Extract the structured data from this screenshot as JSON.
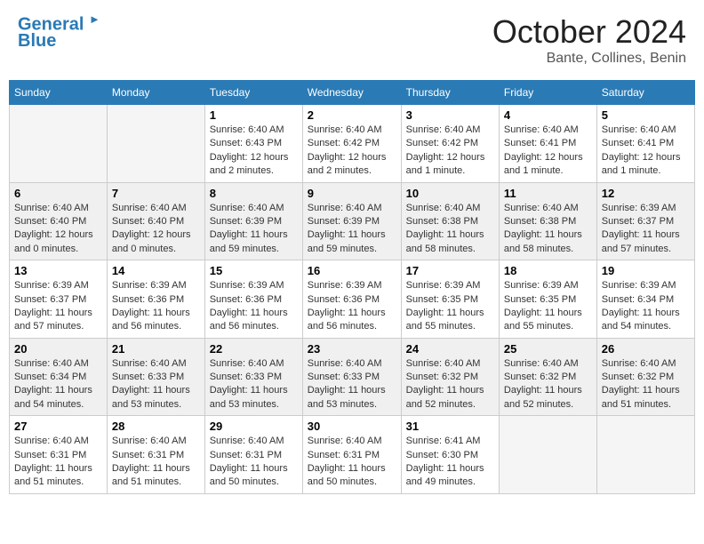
{
  "header": {
    "logo_line1": "General",
    "logo_line2": "Blue",
    "title": "October 2024",
    "subtitle": "Bante, Collines, Benin"
  },
  "days_of_week": [
    "Sunday",
    "Monday",
    "Tuesday",
    "Wednesday",
    "Thursday",
    "Friday",
    "Saturday"
  ],
  "weeks": [
    [
      {
        "day": "",
        "info": ""
      },
      {
        "day": "",
        "info": ""
      },
      {
        "day": "1",
        "info": "Sunrise: 6:40 AM\nSunset: 6:43 PM\nDaylight: 12 hours and 2 minutes."
      },
      {
        "day": "2",
        "info": "Sunrise: 6:40 AM\nSunset: 6:42 PM\nDaylight: 12 hours and 2 minutes."
      },
      {
        "day": "3",
        "info": "Sunrise: 6:40 AM\nSunset: 6:42 PM\nDaylight: 12 hours and 1 minute."
      },
      {
        "day": "4",
        "info": "Sunrise: 6:40 AM\nSunset: 6:41 PM\nDaylight: 12 hours and 1 minute."
      },
      {
        "day": "5",
        "info": "Sunrise: 6:40 AM\nSunset: 6:41 PM\nDaylight: 12 hours and 1 minute."
      }
    ],
    [
      {
        "day": "6",
        "info": "Sunrise: 6:40 AM\nSunset: 6:40 PM\nDaylight: 12 hours and 0 minutes."
      },
      {
        "day": "7",
        "info": "Sunrise: 6:40 AM\nSunset: 6:40 PM\nDaylight: 12 hours and 0 minutes."
      },
      {
        "day": "8",
        "info": "Sunrise: 6:40 AM\nSunset: 6:39 PM\nDaylight: 11 hours and 59 minutes."
      },
      {
        "day": "9",
        "info": "Sunrise: 6:40 AM\nSunset: 6:39 PM\nDaylight: 11 hours and 59 minutes."
      },
      {
        "day": "10",
        "info": "Sunrise: 6:40 AM\nSunset: 6:38 PM\nDaylight: 11 hours and 58 minutes."
      },
      {
        "day": "11",
        "info": "Sunrise: 6:40 AM\nSunset: 6:38 PM\nDaylight: 11 hours and 58 minutes."
      },
      {
        "day": "12",
        "info": "Sunrise: 6:39 AM\nSunset: 6:37 PM\nDaylight: 11 hours and 57 minutes."
      }
    ],
    [
      {
        "day": "13",
        "info": "Sunrise: 6:39 AM\nSunset: 6:37 PM\nDaylight: 11 hours and 57 minutes."
      },
      {
        "day": "14",
        "info": "Sunrise: 6:39 AM\nSunset: 6:36 PM\nDaylight: 11 hours and 56 minutes."
      },
      {
        "day": "15",
        "info": "Sunrise: 6:39 AM\nSunset: 6:36 PM\nDaylight: 11 hours and 56 minutes."
      },
      {
        "day": "16",
        "info": "Sunrise: 6:39 AM\nSunset: 6:36 PM\nDaylight: 11 hours and 56 minutes."
      },
      {
        "day": "17",
        "info": "Sunrise: 6:39 AM\nSunset: 6:35 PM\nDaylight: 11 hours and 55 minutes."
      },
      {
        "day": "18",
        "info": "Sunrise: 6:39 AM\nSunset: 6:35 PM\nDaylight: 11 hours and 55 minutes."
      },
      {
        "day": "19",
        "info": "Sunrise: 6:39 AM\nSunset: 6:34 PM\nDaylight: 11 hours and 54 minutes."
      }
    ],
    [
      {
        "day": "20",
        "info": "Sunrise: 6:40 AM\nSunset: 6:34 PM\nDaylight: 11 hours and 54 minutes."
      },
      {
        "day": "21",
        "info": "Sunrise: 6:40 AM\nSunset: 6:33 PM\nDaylight: 11 hours and 53 minutes."
      },
      {
        "day": "22",
        "info": "Sunrise: 6:40 AM\nSunset: 6:33 PM\nDaylight: 11 hours and 53 minutes."
      },
      {
        "day": "23",
        "info": "Sunrise: 6:40 AM\nSunset: 6:33 PM\nDaylight: 11 hours and 53 minutes."
      },
      {
        "day": "24",
        "info": "Sunrise: 6:40 AM\nSunset: 6:32 PM\nDaylight: 11 hours and 52 minutes."
      },
      {
        "day": "25",
        "info": "Sunrise: 6:40 AM\nSunset: 6:32 PM\nDaylight: 11 hours and 52 minutes."
      },
      {
        "day": "26",
        "info": "Sunrise: 6:40 AM\nSunset: 6:32 PM\nDaylight: 11 hours and 51 minutes."
      }
    ],
    [
      {
        "day": "27",
        "info": "Sunrise: 6:40 AM\nSunset: 6:31 PM\nDaylight: 11 hours and 51 minutes."
      },
      {
        "day": "28",
        "info": "Sunrise: 6:40 AM\nSunset: 6:31 PM\nDaylight: 11 hours and 51 minutes."
      },
      {
        "day": "29",
        "info": "Sunrise: 6:40 AM\nSunset: 6:31 PM\nDaylight: 11 hours and 50 minutes."
      },
      {
        "day": "30",
        "info": "Sunrise: 6:40 AM\nSunset: 6:31 PM\nDaylight: 11 hours and 50 minutes."
      },
      {
        "day": "31",
        "info": "Sunrise: 6:41 AM\nSunset: 6:30 PM\nDaylight: 11 hours and 49 minutes."
      },
      {
        "day": "",
        "info": ""
      },
      {
        "day": "",
        "info": ""
      }
    ]
  ]
}
